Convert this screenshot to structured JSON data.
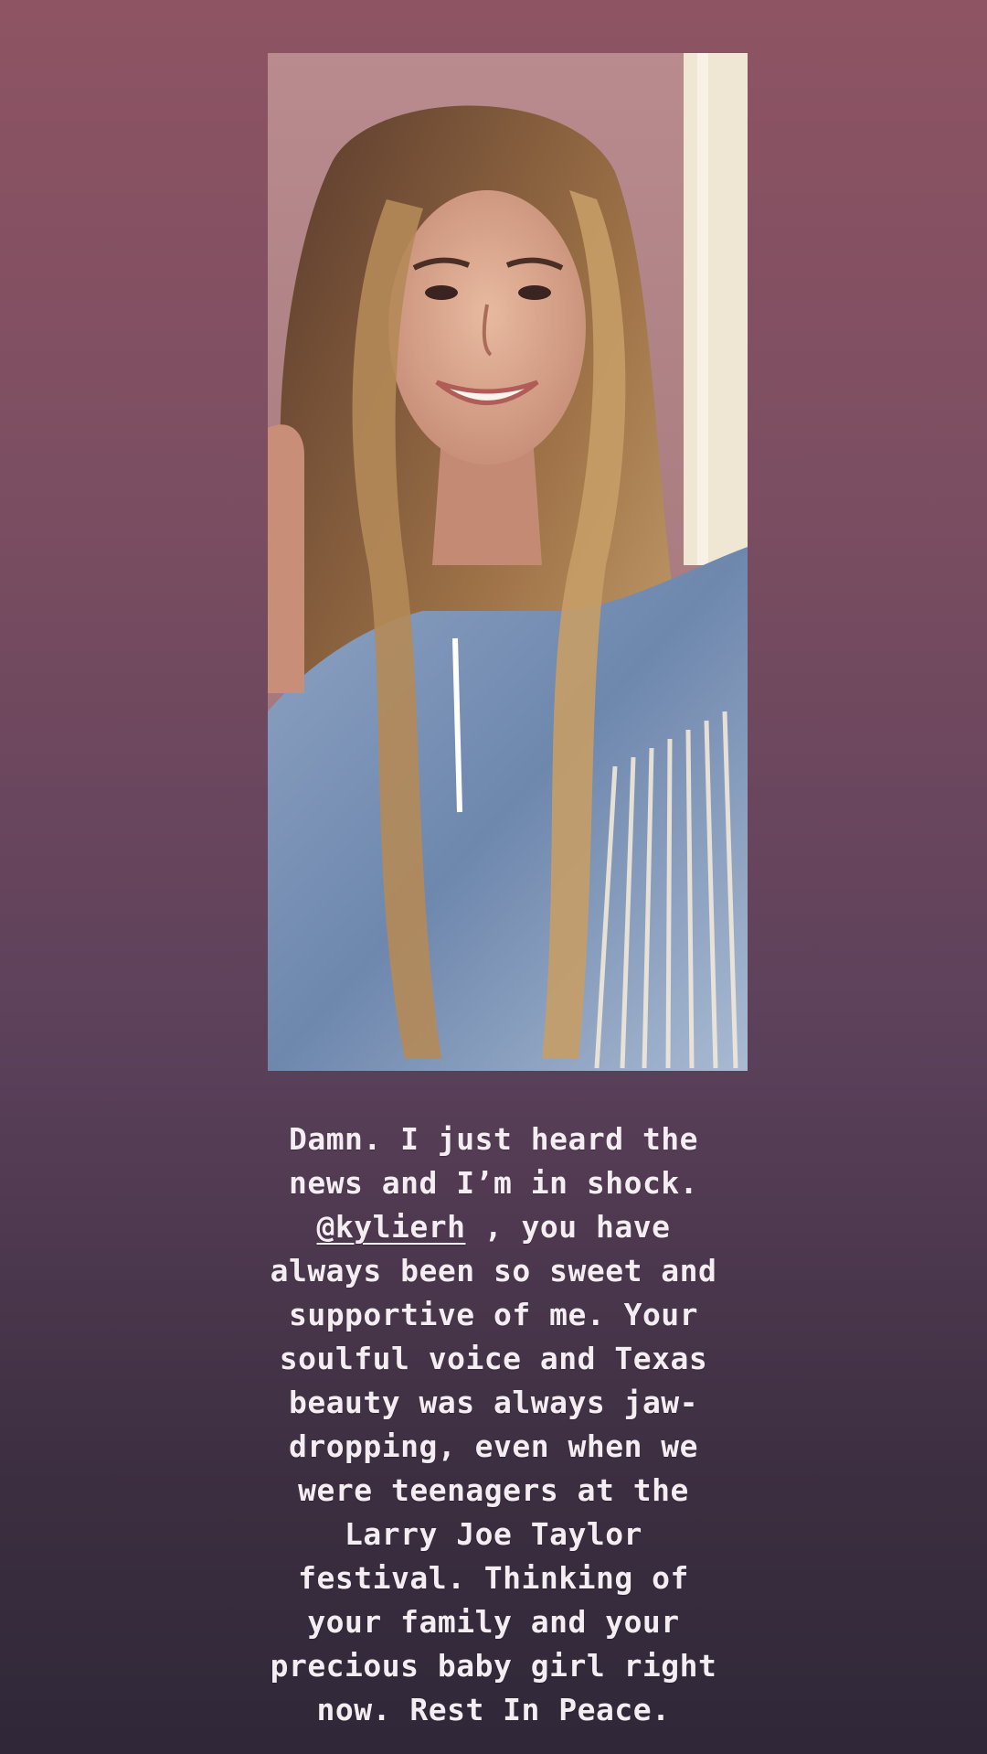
{
  "story": {
    "caption_lines": {
      "l1": "Damn. I just heard the",
      "l2": "news and I’m in shock.",
      "l3_suffix": " , you have",
      "l4": "always been so sweet and",
      "l5": "supportive of me. Your",
      "l6": "soulful voice and Texas",
      "l7": "beauty was always jaw-",
      "l8": "dropping, even when we",
      "l9": "were teenagers at the",
      "l10": "Larry Joe Taylor",
      "l11": "festival. Thinking of",
      "l12": "your family and your",
      "l13": "precious baby girl right",
      "l14": "now. Rest In Peace."
    },
    "mention": "@kylierh"
  },
  "colors": {
    "background_top": "#8e5463",
    "background_bottom": "#2f2838",
    "text": "#f4eef2"
  }
}
